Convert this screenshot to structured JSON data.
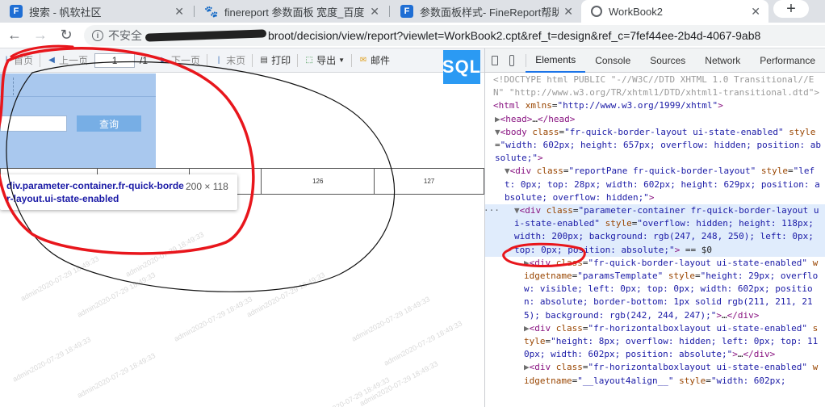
{
  "browser": {
    "tabs": [
      {
        "title": "搜索 - 帆软社区",
        "favicon": "fr-logo-icon"
      },
      {
        "title": "finereport 参数面板 宽度_百度搜",
        "favicon": "baidu-paw-icon"
      },
      {
        "title": "参数面板样式- FineReport帮助文",
        "favicon": "fr-logo-icon"
      },
      {
        "title": "WorkBook2",
        "favicon": "globe-icon"
      }
    ],
    "new_tab_label": "+",
    "insecure_label": "不安全",
    "url": "broot/decision/view/report?viewlet=WorkBook2.cpt&ref_t=design&ref_c=7fef44ee-2b4d-4067-9ab8"
  },
  "report_toolbar": {
    "first": "首页",
    "prev": "上一页",
    "page_value": "1",
    "page_total": "/1",
    "next": "下一页",
    "last": "末页",
    "print": "打印",
    "export": "导出",
    "mail": "邮件",
    "sql": "SQL"
  },
  "params": {
    "query_label": "查询"
  },
  "table": {
    "cells": [
      "",
      "",
      "",
      "126",
      "127"
    ]
  },
  "tooltip": {
    "selector": "div.parameter-container.fr-quick-border-layout.ui-state-enabled",
    "dimensions": "200 × 118"
  },
  "watermark": "admin2020-07-29 18:49:33",
  "devtools": {
    "tabs": [
      "Elements",
      "Console",
      "Sources",
      "Network",
      "Performance"
    ],
    "active_tab": "Elements"
  },
  "colors": {
    "annotation_red": "#e8161c",
    "param_bg": "#a9c8ee",
    "query_btn": "#77aee5",
    "sql_btn": "#2b9af3"
  }
}
